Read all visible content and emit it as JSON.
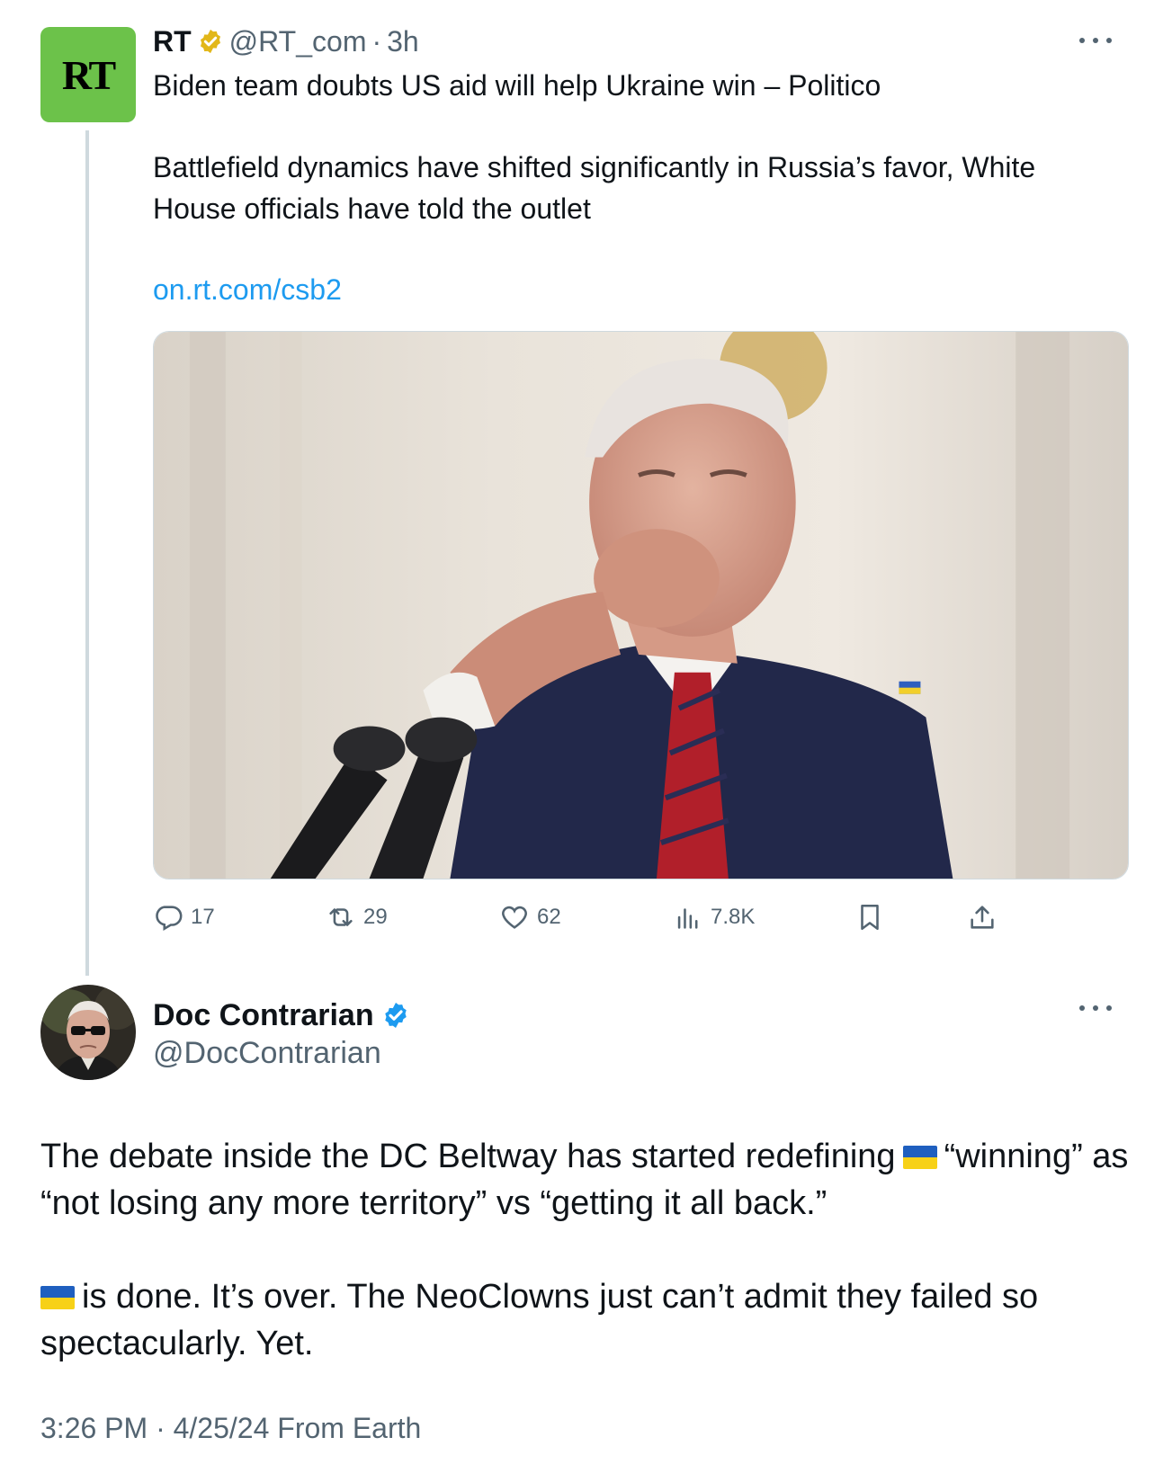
{
  "parent_tweet": {
    "avatar_text": "RT",
    "name": "RT",
    "handle": "@RT_com",
    "separator": "·",
    "time": "3h",
    "headline": "Biden team doubts US aid will help Ukraine win – Politico",
    "body": "Battlefield dynamics have shifted significantly in Russia’s favor, White House officials have told the outlet",
    "link": "on.rt.com/csb2",
    "actions": {
      "replies": "17",
      "reposts": "29",
      "likes": "62",
      "views": "7.8K"
    },
    "colors": {
      "avatar_bg": "#6cc24a",
      "link": "#1d9bf0",
      "badge": "#e2b719"
    }
  },
  "main_tweet": {
    "name": "Doc Contrarian",
    "handle": "@DocContrarian",
    "para1_before_flag": "The debate inside the DC Beltway has started redefining",
    "para1_after_flag": "“winning” as “not losing any more territory” vs “getting it all back.”",
    "para2_after_flag": "is done. It’s over. The NeoClowns just can’t admit they failed so spectacularly. Yet.",
    "timestamp": "3:26 PM · 4/25/24 From Earth",
    "colors": {
      "badge": "#1d9bf0"
    }
  }
}
